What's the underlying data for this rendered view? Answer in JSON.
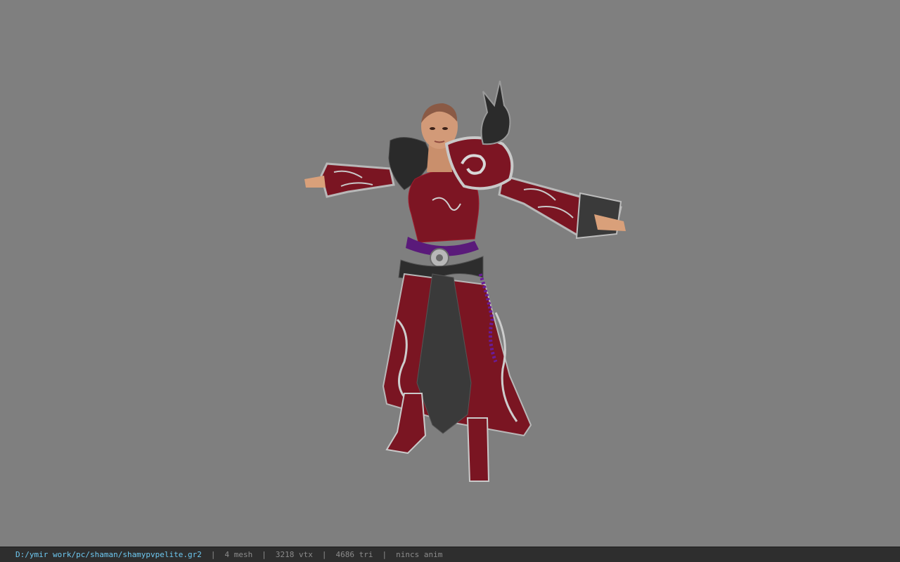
{
  "viewport": {
    "background": "#7f7f7f",
    "model_description": "shaman-character-model"
  },
  "status_bar": {
    "file_path": "D:/ymir work/pc/shaman/shamypvpelite.gr2",
    "separator": "|",
    "mesh": "4 mesh",
    "vtx": "3218 vtx",
    "tri": "4686 tri",
    "anim": "nincs anim",
    "path_color": "#6ec8f0"
  }
}
